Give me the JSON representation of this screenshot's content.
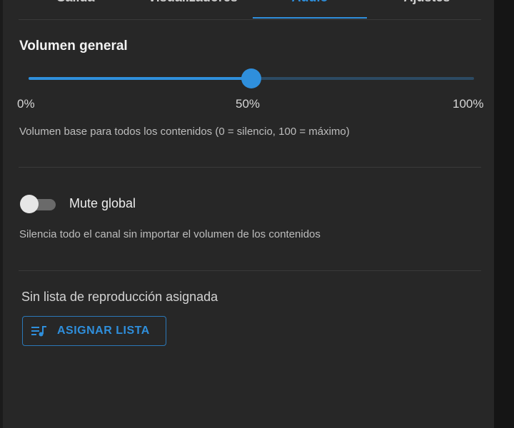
{
  "tabs": [
    {
      "label": "Salida"
    },
    {
      "label": "Visualizadores"
    },
    {
      "label": "Audio",
      "active": true
    },
    {
      "label": "Ajustes"
    }
  ],
  "volume": {
    "title": "Volumen general",
    "value_percent": 50,
    "marks": [
      "0%",
      "50%",
      "100%"
    ],
    "helper": "Volumen base para todos los contenidos (0 = silencio, 100 = máximo)"
  },
  "mute": {
    "label": "Mute global",
    "enabled": false,
    "helper": "Silencia todo el canal sin importar el volumen de los contenidos"
  },
  "playlist": {
    "status": "Sin lista de reproducción asignada",
    "assign_label": "ASIGNAR LISTA",
    "icon": "playlist-music-icon"
  },
  "colors": {
    "accent": "#2f8fdc",
    "panel": "#272727"
  }
}
